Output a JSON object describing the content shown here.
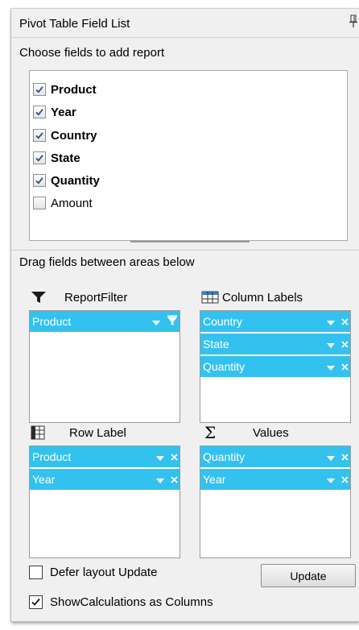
{
  "panel": {
    "title": "Pivot Table Field List",
    "pin_icon": "pin-icon",
    "choose_label": "Choose fields to add report",
    "fields": [
      {
        "label": "Product",
        "checked": true
      },
      {
        "label": "Year",
        "checked": true
      },
      {
        "label": "Country",
        "checked": true
      },
      {
        "label": "State",
        "checked": true
      },
      {
        "label": "Quantity",
        "checked": true
      },
      {
        "label": "Amount",
        "checked": false
      }
    ],
    "drag_label": "Drag fields between areas below"
  },
  "areas": {
    "report_filter": {
      "label": "ReportFilter",
      "icon": "filter-icon",
      "items": [
        "Product"
      ]
    },
    "column_labels": {
      "label": "Column Labels",
      "icon": "table-icon",
      "items": [
        "Country",
        "State",
        "Quantity"
      ]
    },
    "row_label": {
      "label": "Row Label",
      "icon": "row-grid-icon",
      "items": [
        "Product",
        "Year"
      ]
    },
    "values": {
      "label": "Values",
      "icon": "sigma-icon",
      "symbol": "Σ",
      "items": [
        "Quantity",
        "Year"
      ]
    }
  },
  "footer": {
    "defer_label": "Defer layout Update",
    "defer_checked": false,
    "update_label": "Update",
    "show_calc_label": "ShowCalculations as Columns",
    "show_calc_checked": true
  },
  "colors": {
    "chip_bg": "#33c2ef",
    "panel_bg": "#f0f0f0"
  }
}
